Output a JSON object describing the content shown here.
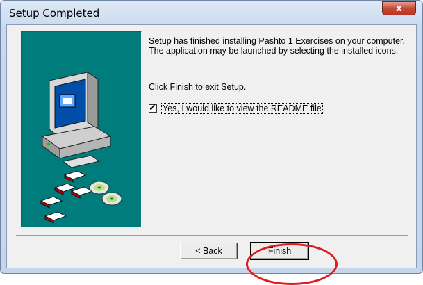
{
  "window": {
    "title": "Setup Completed",
    "close_glyph": "x"
  },
  "content": {
    "message": "Setup has finished installing Pashto 1 Exercises on your computer. The application may be launched by selecting the installed icons.",
    "instruction": "Click Finish to exit Setup.",
    "readme_checkbox": {
      "label": "Yes, I would like to view the README file",
      "checked": true
    }
  },
  "buttons": {
    "back": "< Back",
    "finish": "Finish"
  },
  "colors": {
    "panel": "#007c7c",
    "highlight_ring": "#e01b1b"
  },
  "icons": [
    "computer-icon",
    "diskette-icon",
    "cd-icon",
    "close-icon",
    "checkmark-icon"
  ]
}
